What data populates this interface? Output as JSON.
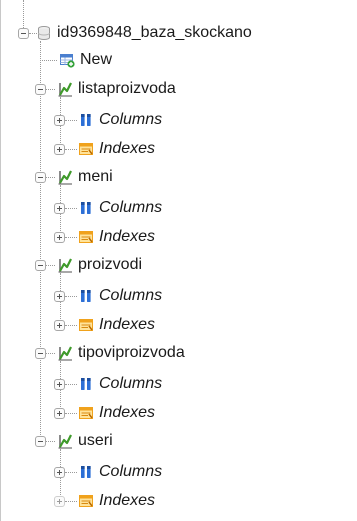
{
  "database": {
    "name": "id9369848_baza_skockano",
    "icon": "database-icon",
    "expanded": true
  },
  "new_item": {
    "label": "New",
    "icon": "new-table-icon"
  },
  "tables": [
    {
      "name": "listaproizvoda",
      "icon": "table-icon",
      "expanded": true,
      "children": [
        {
          "label": "Columns",
          "icon": "columns-icon"
        },
        {
          "label": "Indexes",
          "icon": "indexes-icon"
        }
      ]
    },
    {
      "name": "meni",
      "icon": "table-icon",
      "expanded": true,
      "children": [
        {
          "label": "Columns",
          "icon": "columns-icon"
        },
        {
          "label": "Indexes",
          "icon": "indexes-icon"
        }
      ]
    },
    {
      "name": "proizvodi",
      "icon": "table-icon",
      "expanded": true,
      "children": [
        {
          "label": "Columns",
          "icon": "columns-icon"
        },
        {
          "label": "Indexes",
          "icon": "indexes-icon"
        }
      ]
    },
    {
      "name": "tipoviproizvoda",
      "icon": "table-icon",
      "expanded": true,
      "children": [
        {
          "label": "Columns",
          "icon": "columns-icon"
        },
        {
          "label": "Indexes",
          "icon": "indexes-icon"
        }
      ]
    },
    {
      "name": "useri",
      "icon": "table-icon",
      "expanded": true,
      "children": [
        {
          "label": "Columns",
          "icon": "columns-icon"
        },
        {
          "label": "Indexes",
          "icon": "indexes-icon"
        }
      ]
    }
  ],
  "colors": {
    "text": "#1a1a1a",
    "connector": "#9a9a9a",
    "columns_icon": "#2c6fd6",
    "indexes_icon": "#f0a21c",
    "table_icon_green": "#3f9a2b",
    "new_icon_blue": "#4a7fcf",
    "new_icon_green": "#35a23a"
  }
}
